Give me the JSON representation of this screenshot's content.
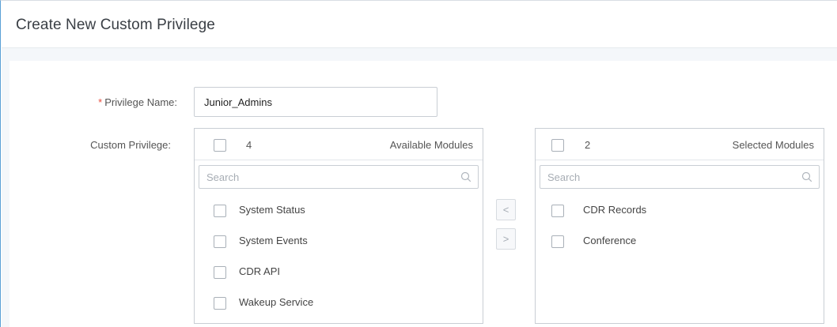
{
  "dialog": {
    "title": "Create New Custom Privilege"
  },
  "form": {
    "privilege_name_label": "Privilege Name:",
    "required_mark": "*",
    "privilege_name_value": "Junior_Admins",
    "custom_privilege_label": "Custom Privilege:"
  },
  "available": {
    "count": "4",
    "title": "Available Modules",
    "search_placeholder": "Search",
    "items": [
      {
        "label": "System Status"
      },
      {
        "label": "System Events"
      },
      {
        "label": "CDR API"
      },
      {
        "label": "Wakeup Service"
      }
    ]
  },
  "selected": {
    "count": "2",
    "title": "Selected Modules",
    "search_placeholder": "Search",
    "items": [
      {
        "label": "CDR Records"
      },
      {
        "label": "Conference"
      }
    ]
  },
  "transfer": {
    "move_left_label": "<",
    "move_right_label": ">"
  },
  "colors": {
    "required": "#e84c3d",
    "accent_border": "#5aa0d6"
  }
}
